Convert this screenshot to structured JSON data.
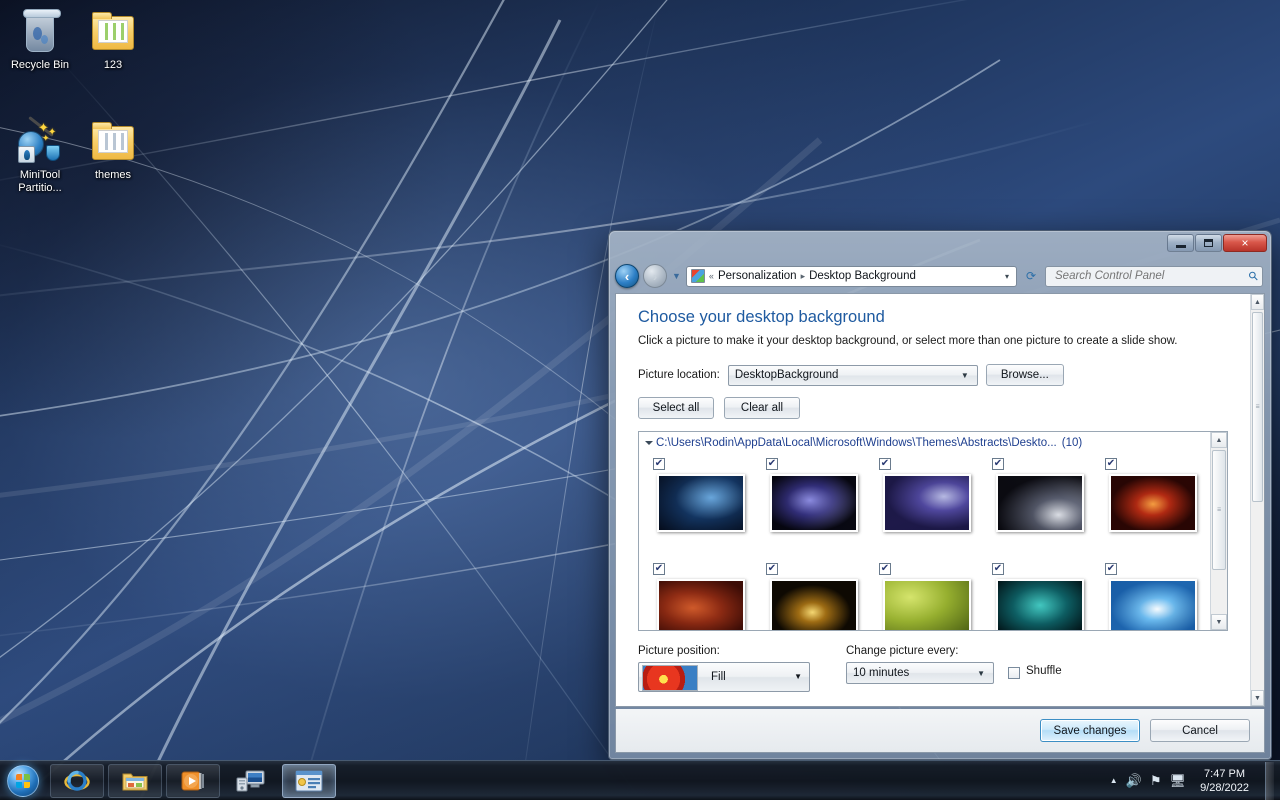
{
  "desktop": {
    "icons": [
      {
        "label": "Recycle Bin",
        "icon": "recycle-bin-icon"
      },
      {
        "label": "123",
        "icon": "folder-icon"
      },
      {
        "label": "MiniTool Partitio...",
        "icon": "minitool-partition-wizard-icon"
      },
      {
        "label": "themes",
        "icon": "folder-icon"
      }
    ]
  },
  "window": {
    "titlebar": {
      "minimize_label": "Minimize",
      "maximize_label": "Maximize",
      "close_label": "×"
    },
    "nav": {
      "back_label": "←",
      "forward_label": "→",
      "history_caret": "▾",
      "refresh_label": "↻",
      "breadcrumb_overflow": "«",
      "breadcrumbs": [
        "Personalization",
        "Desktop Background"
      ],
      "separator": "▸",
      "address_caret": "▾"
    },
    "search": {
      "placeholder": "Search Control Panel",
      "value": "",
      "icon": "search-icon"
    }
  },
  "main": {
    "page_title": "Choose your desktop background",
    "subtitle": "Click a picture to make it your desktop background, or select more than one picture to create a slide show.",
    "picture_location_label": "Picture location:",
    "picture_location_value": "DesktopBackground",
    "browse_label": "Browse...",
    "select_all_label": "Select all",
    "clear_all_label": "Clear all",
    "list": {
      "path": "C:\\Users\\Rodin\\AppData\\Local\\Microsoft\\Windows\\Themes\\Abstracts\\Deskto...",
      "count": "(10)",
      "thumbnails": [
        {
          "name": "abstract-blue-lines",
          "checked": true,
          "css": "radial-gradient(ellipse at 62% 40%, rgba(120,185,240,0.85) 0%, rgba(20,50,95,0.6) 48%, rgba(4,10,24,0.95) 100%), linear-gradient(135deg,#06101f,#123a66 55%,#04101f)"
        },
        {
          "name": "abstract-purple-crystal",
          "checked": true,
          "css": "radial-gradient(ellipse at 45% 45%, rgba(150,150,235,0.9) 0%, rgba(55,50,130,0.7) 35%, rgba(5,5,14,0.98) 75%), linear-gradient(120deg,#04040a,#2a2a6e 48%,#c9d2dd 92%)"
        },
        {
          "name": "abstract-violet-burst",
          "checked": true,
          "css": "radial-gradient(ellipse at 70% 38%, rgba(205,210,245,0.85) 0%, rgba(88,80,170,0.75) 30%, rgba(28,24,70,0.95) 68%), linear-gradient(160deg,#120f34,#3b3184 60%,#0a0822)"
        },
        {
          "name": "abstract-dark-spike",
          "checked": true,
          "css": "radial-gradient(ellipse at 72% 72%, rgba(235,238,244,0.9) 0%, rgba(95,100,118,0.7) 30%, rgba(10,10,16,0.97) 72%), linear-gradient(45deg,#06060a,#4a4e5e 70%,#d6dae2)"
        },
        {
          "name": "abstract-red-embers",
          "checked": true,
          "css": "radial-gradient(ellipse at 50% 52%, rgba(255,170,70,0.9) 0%, rgba(195,45,20,0.75) 28%, rgba(40,6,4,0.98) 70%), linear-gradient(140deg,#1a0503,#8d2410 55%,#140302)"
        },
        {
          "name": "abstract-copper-swirl",
          "checked": true,
          "css": "radial-gradient(ellipse at 40% 50%, rgba(215,95,45,0.85) 0%, rgba(140,40,18,0.8) 40%, rgba(60,12,6,0.98) 85%), linear-gradient(30deg,#3d0d05,#a8411d 50%,#2a0803)"
        },
        {
          "name": "abstract-golden-starburst",
          "checked": true,
          "css": "radial-gradient(ellipse at 48% 58%, rgba(255,225,120,0.95) 0%, rgba(205,140,25,0.7) 22%, rgba(14,9,2,0.99) 62%), linear-gradient(180deg,#080602,#3a2708 70%,#060400)"
        },
        {
          "name": "abstract-olive-leaf",
          "checked": true,
          "css": "radial-gradient(ellipse at 30% 30%, rgba(215,230,110,0.95) 0%, rgba(150,175,45,0.85) 45%, rgba(70,90,18,0.95) 100%), linear-gradient(135deg,#c7dc5e,#6d8a1e)"
        },
        {
          "name": "abstract-teal-ornate",
          "checked": true,
          "css": "radial-gradient(ellipse at 50% 45%, rgba(80,225,215,0.8) 0%, rgba(14,95,100,0.85) 45%, rgba(2,22,26,0.98) 90%), linear-gradient(160deg,#031a1e,#0d6b6f 55%,#021116)"
        },
        {
          "name": "abstract-blue-white-wave",
          "checked": true,
          "css": "radial-gradient(ellipse at 55% 52%, rgba(255,255,255,0.95) 0%, rgba(120,195,245,0.7) 28%, rgba(25,95,170,0.9) 70%), linear-gradient(135deg,#0c3c78,#52aee8 55%,#09325f)"
        }
      ],
      "scroll_up": "▲",
      "scroll_down": "▼"
    },
    "picture_position_label": "Picture position:",
    "picture_position_value": "Fill",
    "change_picture_label": "Change picture every:",
    "change_picture_value": "10 minutes",
    "shuffle_label": "Shuffle",
    "shuffle_checked": false
  },
  "footer": {
    "save_label": "Save changes",
    "cancel_label": "Cancel"
  },
  "taskbar": {
    "start_label": "Start",
    "buttons": [
      {
        "name": "internet-explorer",
        "label": "Internet Explorer"
      },
      {
        "name": "windows-explorer",
        "label": "Windows Explorer"
      },
      {
        "name": "windows-media-player",
        "label": "Windows Media Player"
      },
      {
        "name": "computer-network",
        "label": "Computer"
      },
      {
        "name": "personalization-window",
        "label": "Desktop Background"
      }
    ],
    "tray": {
      "show_hidden": "▲",
      "volume_icon": "volume-icon",
      "network_icon": "network-icon",
      "action_center_icon": "action-center-icon",
      "time": "7:47 PM",
      "date": "9/28/2022"
    }
  },
  "colors": {
    "accent_blue": "#1e5aa0",
    "path_blue": "#1e3f8f",
    "close_red": "#d9574a",
    "primary_btn_border": "#3c8ec4"
  }
}
